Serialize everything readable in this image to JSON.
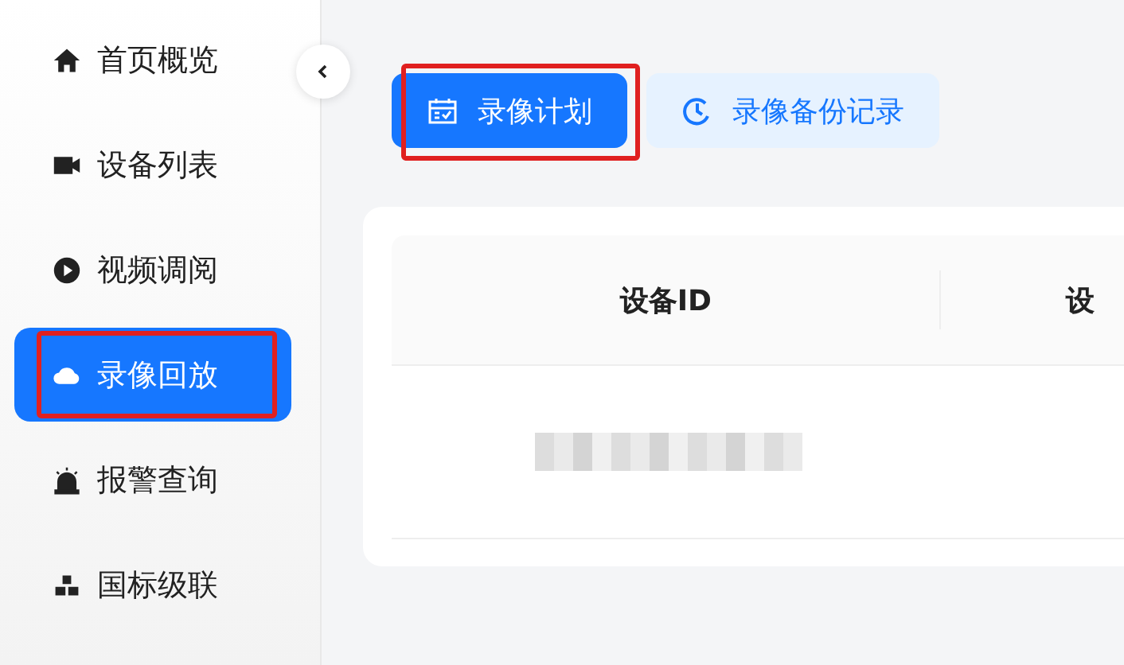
{
  "sidebar": {
    "items": [
      {
        "label": "首页概览",
        "kind": "home",
        "selected": false,
        "highlighted": false
      },
      {
        "label": "设备列表",
        "kind": "camera",
        "selected": false,
        "highlighted": false
      },
      {
        "label": "视频调阅",
        "kind": "play",
        "selected": false,
        "highlighted": false
      },
      {
        "label": "录像回放",
        "kind": "cloud",
        "selected": true,
        "highlighted": true
      },
      {
        "label": "报警查询",
        "kind": "alarm",
        "selected": false,
        "highlighted": false
      },
      {
        "label": "国标级联",
        "kind": "blocks",
        "selected": false,
        "highlighted": false
      }
    ]
  },
  "tabs": [
    {
      "label": "录像计划",
      "kind": "calendar",
      "selected": true,
      "highlighted": true
    },
    {
      "label": "录像备份记录",
      "kind": "clock",
      "selected": false,
      "highlighted": false
    }
  ],
  "table": {
    "columns": [
      "设备ID",
      "设"
    ],
    "rows": [
      {
        "redacted": true
      }
    ]
  }
}
